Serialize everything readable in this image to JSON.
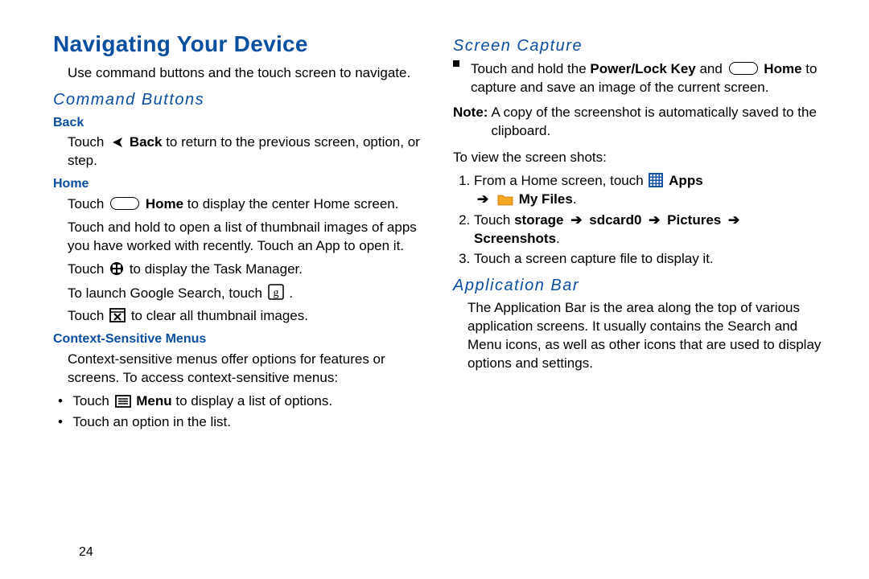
{
  "page_number": "24",
  "title": "Navigating Your Device",
  "intro": "Use command buttons and the touch screen to navigate.",
  "cmd_buttons_h": "Command Buttons",
  "back_h": "Back",
  "back_p_a": "Touch ",
  "back_label": "Back",
  "back_p_b": " to return to the previous screen, option, or step.",
  "home_h": "Home",
  "home_p1_a": "Touch ",
  "home_label": "Home",
  "home_p1_b": " to display the center Home screen.",
  "home_p2": "Touch and hold to open a list of thumbnail images of apps you have worked with recently. Touch an App to open it.",
  "home_p3_a": "Touch ",
  "home_p3_b": " to display the Task Manager.",
  "home_p4_a": "To launch Google Search, touch ",
  "home_p4_b": ".",
  "home_p5_a": "Touch ",
  "home_p5_b": " to clear all thumbnail images.",
  "ctx_h": "Context-Sensitive Menus",
  "ctx_p": "Context-sensitive menus offer options for features or screens. To access context-sensitive menus:",
  "ctx_b1_a": "Touch ",
  "menu_label": "Menu",
  "ctx_b1_b": " to display a list of options.",
  "ctx_b2": "Touch an option in the list.",
  "sc_h": "Screen Capture",
  "sc_b_a": "Touch and hold the ",
  "sc_power": "Power/Lock Key",
  "sc_b_mid": " and ",
  "sc_home": "Home",
  "sc_b_b": " to capture and save an image of the current screen.",
  "note_label": "Note:",
  "note_body": "A copy of the screenshot is automatically saved to the clipboard.",
  "sc_view": "To view the screen shots:",
  "step1_a": "From a Home screen, touch ",
  "apps_label": "Apps",
  "step1_arrow": "➔",
  "myfiles_label": "My Files",
  "step1_end": ".",
  "step2_a": "Touch ",
  "step2_storage": "storage",
  "step2_sd": "sdcard0",
  "step2_pic": "Pictures",
  "step2_ss": "Screenshots",
  "step2_end": ".",
  "step3": "Touch a screen capture file to display it.",
  "appbar_h": "Application Bar",
  "appbar_p": "The Application Bar is the area along the top of various application screens. It usually contains the Search and Menu icons, as well as other icons that are used to display options and settings."
}
